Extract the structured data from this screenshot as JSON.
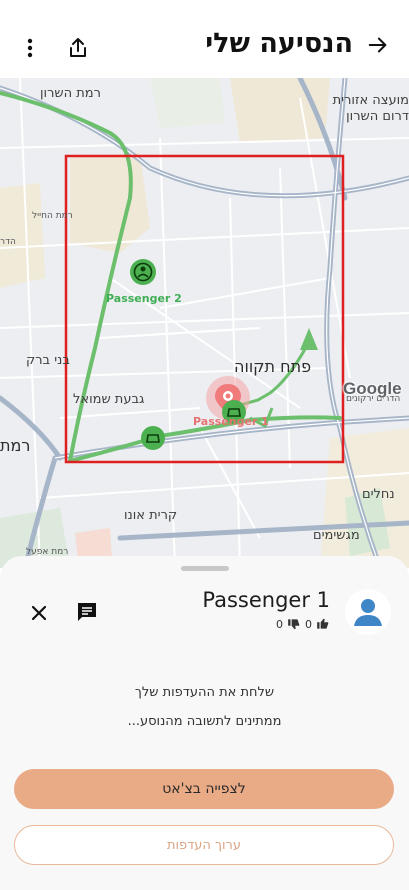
{
  "header": {
    "title": "הנסיעה שלי",
    "back_icon": "arrow-right-icon",
    "share_icon": "share-icon",
    "more_icon": "more-vert-icon"
  },
  "map": {
    "labels": {
      "ramat_hasharon": "רמת השרון",
      "regional_council_1": "מועצה אזורית",
      "regional_council_2": "דרום השרון",
      "ramat_hahayal": "רמת החייל",
      "hadar": "הדר",
      "bnei_brak": "בני ברק",
      "petah_tikva": "פתח תקווה",
      "givat_shmuel": "גבעת שמואל",
      "ramat_gan": "רמת",
      "kiryat_ono": "קרית אונו",
      "nehalim": "נחלים",
      "magshimim": "מגשימים",
      "ramat_efal": "רמת אפעל",
      "hadarim": "הדרים ירקונים"
    },
    "passenger2_label": "Passenger 2",
    "passenger1_label": "Passenger 1",
    "google_logo": "Google",
    "colors": {
      "route": "#5cb85c",
      "marker": "#4caf50",
      "selection": "#e02020",
      "pin": "#ef7b7b"
    }
  },
  "sheet": {
    "passenger_name": "Passenger 1",
    "dislikes": "0",
    "likes": "0",
    "message_line1": "שלחת את ההעדפות שלך",
    "message_line2": "ממתינים לתשובה מהנוסע...",
    "primary_button": "לצפייה בצ'אט",
    "secondary_button": "ערוך העדפות",
    "accent_color": "#e9aa86"
  }
}
